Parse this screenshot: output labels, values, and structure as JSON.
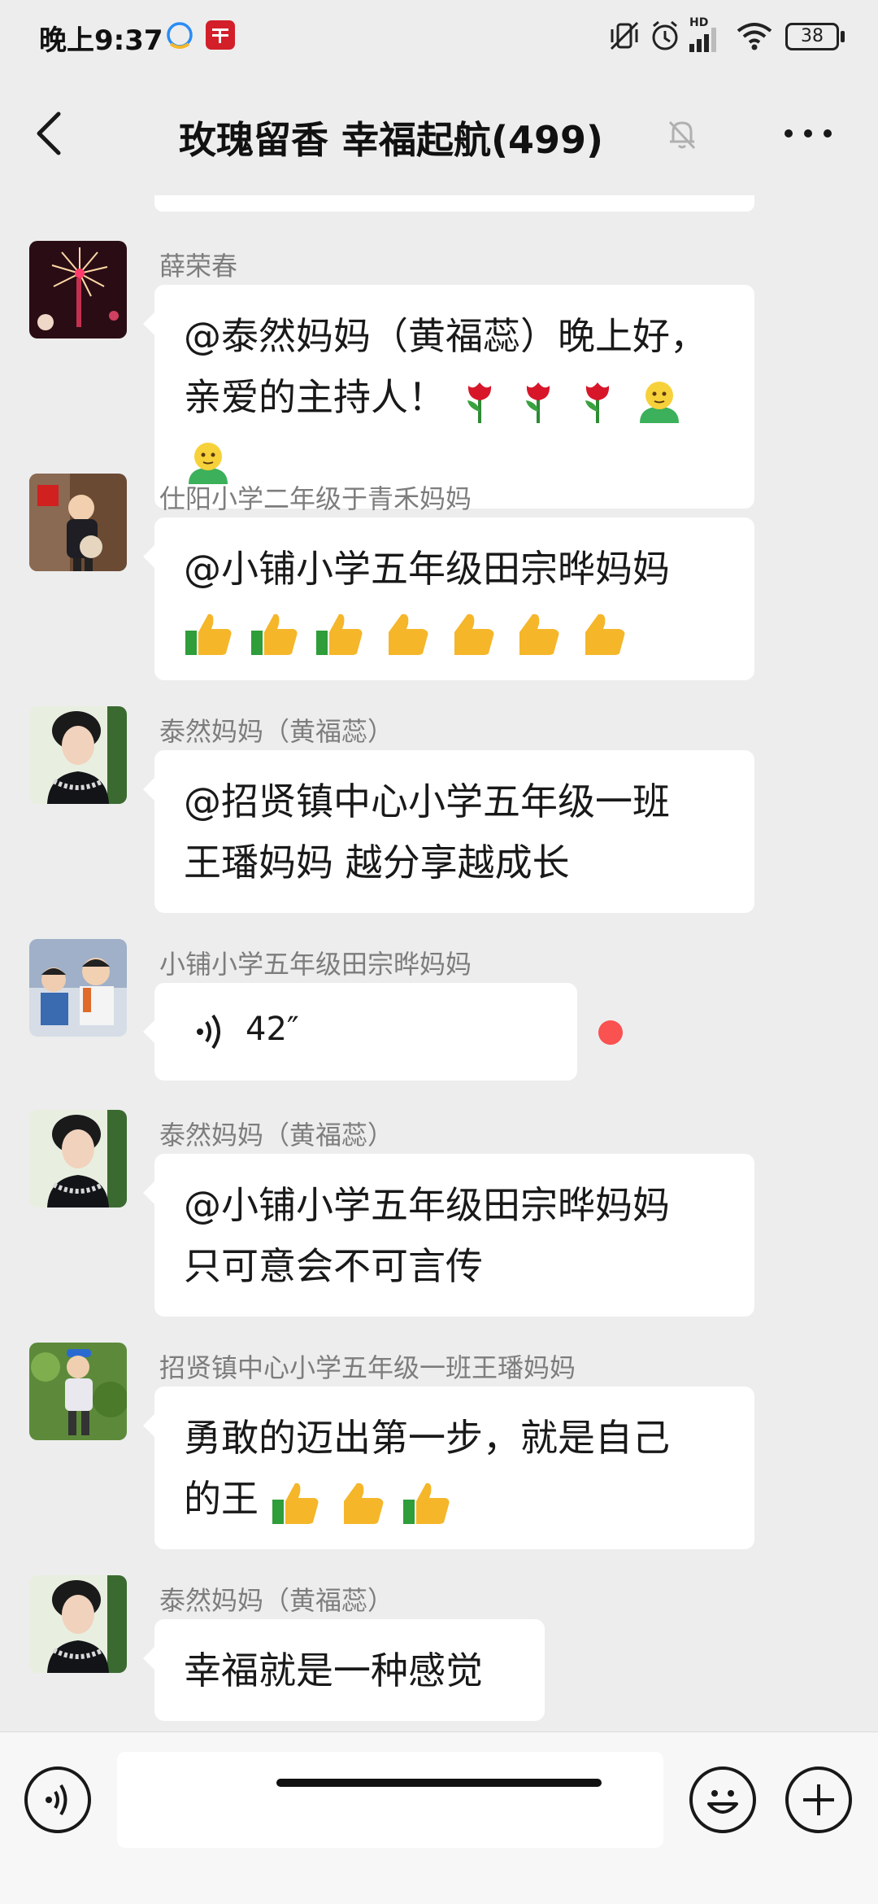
{
  "status_bar": {
    "time": "晚上9:37",
    "network_label": "HD",
    "battery": "38",
    "icons": [
      "qq-notification-icon",
      "app-notification-icon",
      "mute-vibrate-icon",
      "alarm-icon",
      "signal-icon",
      "wifi-icon",
      "battery-icon"
    ]
  },
  "header": {
    "title": "玫瑰留香  幸福起航(499)",
    "muted": true,
    "icons": [
      "back-icon",
      "mute-bell-icon",
      "more-icon"
    ]
  },
  "messages": [
    {
      "sender": "薛荣春",
      "lines": [
        "@泰然妈妈（黄福蕊）晚上好，",
        "亲爱的主持人！"
      ],
      "emojis": [
        "rose",
        "rose",
        "rose",
        "hug",
        "hug"
      ]
    },
    {
      "sender": "仕阳小学二年级于青禾妈妈",
      "lines": [
        "@小铺小学五年级田宗晔妈妈"
      ],
      "emojis": [
        "thumbs-up",
        "thumbs-up",
        "thumbs-up",
        "thumbs-up",
        "thumbs-up",
        "thumbs-up",
        "thumbs-up"
      ]
    },
    {
      "sender": "泰然妈妈（黄福蕊）",
      "lines": [
        "@招贤镇中心小学五年级一班",
        "王璠妈妈  越分享越成长"
      ]
    },
    {
      "sender": "小铺小学五年级田宗晔妈妈",
      "voice": {
        "duration": "42″",
        "unread": true
      }
    },
    {
      "sender": "泰然妈妈（黄福蕊）",
      "lines": [
        "@小铺小学五年级田宗晔妈妈",
        "只可意会不可言传"
      ]
    },
    {
      "sender": "招贤镇中心小学五年级一班王璠妈妈",
      "lines": [
        "勇敢的迈出第一步，就是自己",
        "的王"
      ],
      "emojis": [
        "thumbs-up",
        "thumbs-up",
        "thumbs-up"
      ]
    },
    {
      "sender": "泰然妈妈（黄福蕊）",
      "lines": [
        "幸福就是一种感觉"
      ]
    }
  ],
  "input_bar": {
    "placeholder": "",
    "icons": [
      "voice-input-icon",
      "emoji-icon",
      "plus-icon"
    ]
  },
  "colors": {
    "background": "#ededed",
    "bubble": "#ffffff",
    "sender_name": "#7d7d7d",
    "unread_dot": "#fa5151"
  }
}
